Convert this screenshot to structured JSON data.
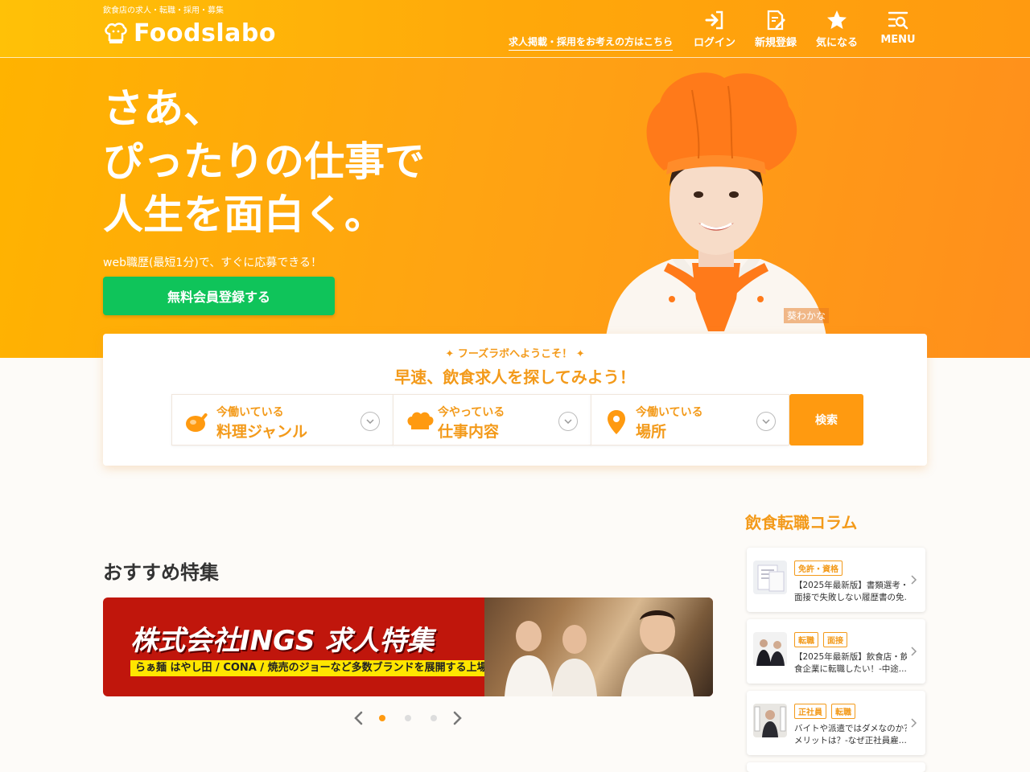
{
  "header": {
    "tagline": "飲食店の求人・転職・採用・募集",
    "logo_text": "Foodslabo",
    "employer_link": "求人掲載・採用をお考えの方はこちら",
    "nav": [
      {
        "label": "ログイン",
        "icon": "login-icon"
      },
      {
        "label": "新規登録",
        "icon": "register-icon"
      },
      {
        "label": "気になる",
        "icon": "star-icon"
      },
      {
        "label": "MENU",
        "icon": "menu-search-icon"
      }
    ]
  },
  "hero": {
    "title_lines": [
      "さあ、",
      "ぴったりの仕事で",
      "人生を面白く。"
    ],
    "subtitle": "web職歴(最短1分)で、すぐに応募できる！",
    "cta": "無料会員登録する",
    "model_name": "葵わかな"
  },
  "search": {
    "welcome": "フーズラボへようこそ！",
    "heading": "早速、飲食求人を探してみよう！",
    "fields": [
      {
        "small": "今働いている",
        "big": "料理ジャンル",
        "icon": "frying-pan-icon"
      },
      {
        "small": "今やっている",
        "big": "仕事内容",
        "icon": "chef-hat-icon"
      },
      {
        "small": "今働いている",
        "big": "場所",
        "icon": "location-pin-icon"
      }
    ],
    "button": "検索"
  },
  "featured": {
    "title": "おすすめ特集",
    "banner_title": "株式会社INGS 求人特集",
    "banner_sub": "らぁ麺 はやし田 / CONA / 焼売のジョーなど多数ブランドを展開する上場企業のスタッフ積極募集！",
    "carousel_dots": 3,
    "active_dot": 1
  },
  "column": {
    "title": "飲食転職コラム",
    "items": [
      {
        "tags": [
          "免許・資格"
        ],
        "line1": "【2025年最新版】書類選考・",
        "line2": "面接で失敗しない履歴書の免..."
      },
      {
        "tags": [
          "転職",
          "面接"
        ],
        "line1": "【2025年最新版】飲食店・飲",
        "line2": "食企業に転職したい！-中途..."
      },
      {
        "tags": [
          "正社員",
          "転職"
        ],
        "line1": "バイトや派遣ではダメなのか？",
        "line2": "メリットは？-なぜ正社員雇..."
      }
    ]
  },
  "colors": {
    "brand_orange": "#ff9a10",
    "accent_text": "#f39a1a",
    "cta_green": "#0fc45a"
  }
}
